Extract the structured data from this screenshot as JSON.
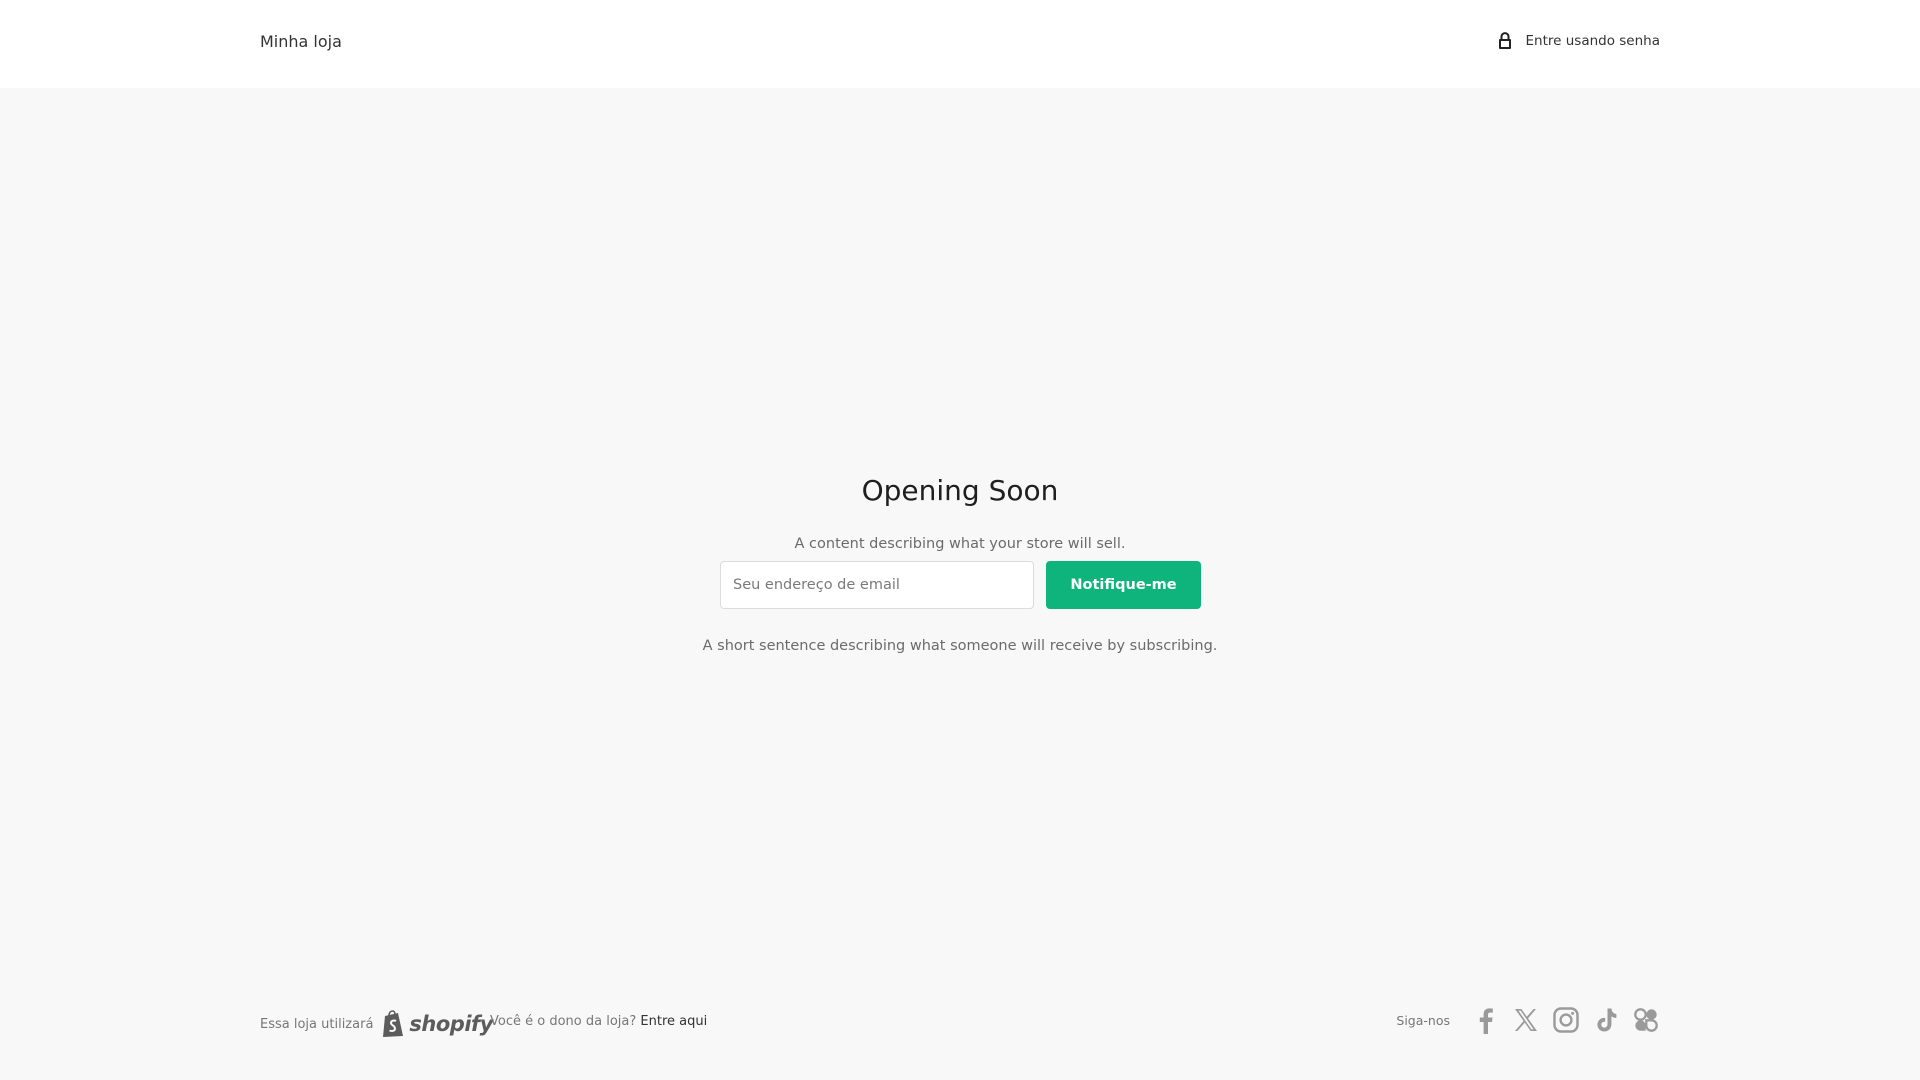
{
  "header": {
    "store_name": "Minha loja",
    "login_label": "Entre usando senha",
    "login_icon": "lock-icon"
  },
  "main": {
    "title": "Opening Soon",
    "description": "A content describing what your store will sell.",
    "email_placeholder": "Seu endereço de email",
    "email_value": "",
    "notify_label": "Notifique-me",
    "subtext": "A short sentence describing what someone will receive by subscribing."
  },
  "footer": {
    "powered_prefix": "Essa loja utilizará",
    "powered_brand": "shopify",
    "owner_question": "Você é o dono da loja?",
    "owner_link": "Entre aqui",
    "follow_label": "Siga-nos",
    "social_icons": [
      "facebook-icon",
      "x-icon",
      "instagram-icon",
      "tiktok-icon",
      "pinterest-icon"
    ]
  },
  "colors": {
    "accent": "#0fb47d",
    "background": "#f8f8f8",
    "header_background": "#ffffff",
    "muted_text": "#6b6b6b",
    "icon_gray": "#9a9a9a"
  }
}
